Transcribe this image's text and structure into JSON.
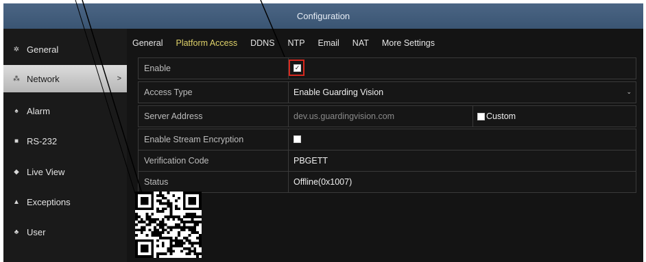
{
  "window": {
    "title": "Configuration"
  },
  "sidebar": {
    "items": [
      {
        "label": "General",
        "icon": "gear-icon",
        "glyph": "✲"
      },
      {
        "label": "Network",
        "icon": "network-icon",
        "glyph": "⁂",
        "active": true,
        "arrow": ">"
      },
      {
        "label": "Alarm",
        "icon": "alarm-icon",
        "glyph": "♠"
      },
      {
        "label": "RS-232",
        "icon": "rs232-icon",
        "glyph": "■"
      },
      {
        "label": "Live View",
        "icon": "live-view-icon",
        "glyph": "◆"
      },
      {
        "label": "Exceptions",
        "icon": "warning-icon",
        "glyph": "▲"
      },
      {
        "label": "User",
        "icon": "user-icon",
        "glyph": "♣"
      }
    ]
  },
  "tabs": [
    "General",
    "Platform Access",
    "DDNS",
    "NTP",
    "Email",
    "NAT",
    "More Settings"
  ],
  "active_tab": "Platform Access",
  "form": {
    "enable": {
      "label": "Enable",
      "checked": true,
      "check_glyph": "✓"
    },
    "access_type": {
      "label": "Access Type",
      "value": "Enable Guarding Vision",
      "caret": "⌄"
    },
    "server_address": {
      "label": "Server Address",
      "value": "dev.us.guardingvision.com",
      "custom_label": "Custom",
      "custom_checked": false
    },
    "stream_encryption": {
      "label": "Enable Stream Encryption",
      "checked": false
    },
    "verification_code": {
      "label": "Verification Code",
      "value": "PBGETT"
    },
    "status": {
      "label": "Status",
      "value": "Offline(0x1007)"
    }
  },
  "colors": {
    "title_bar": "#3f5b7b",
    "active_tab": "#e0d36a",
    "highlight": "#d8281e",
    "background": "#141414"
  }
}
